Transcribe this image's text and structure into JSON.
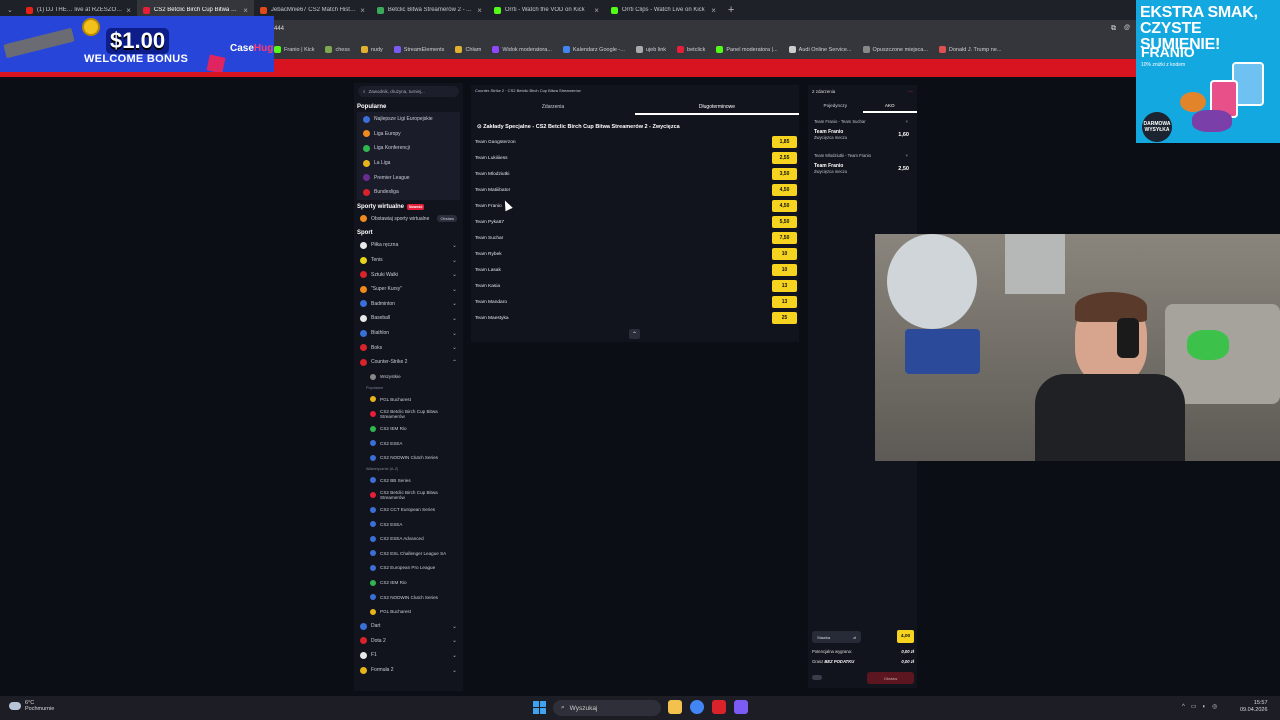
{
  "browser": {
    "tabs": [
      {
        "title": "(1) DJ THE… live at RZESZOW…",
        "color": "#e62117"
      },
      {
        "title": "CS2 Betclic Birch Cup Bitwa Str…",
        "color": "#e81d37",
        "active": true
      },
      {
        "title": "JebacMnie67 CS2 Match Histo…",
        "color": "#e04a1a"
      },
      {
        "title": "Betclic Bitwa Streamerów 2 - A…",
        "color": "#3ba95a"
      },
      {
        "title": "Orrti - Watch the VOD on Kick",
        "color": "#53fc18"
      },
      {
        "title": "Orrti Clips - Watch Live on Kick",
        "color": "#53fc18"
      }
    ],
    "address_fragment": "444",
    "bookmarks": [
      {
        "label": "Franio | Kick",
        "color": "#53fc18"
      },
      {
        "label": "chess",
        "color": "#7fa650"
      },
      {
        "label": "nudy",
        "color": "#e0b030"
      },
      {
        "label": "StreamElements",
        "color": "#7a5cf5"
      },
      {
        "label": "Chłam",
        "color": "#e0b030"
      },
      {
        "label": "Widok moderatora...",
        "color": "#9146ff"
      },
      {
        "label": "Kalendarz Google -...",
        "color": "#4285f4"
      },
      {
        "label": "ujeb link",
        "color": "#aaaaaa"
      },
      {
        "label": "betclick",
        "color": "#e81d37"
      },
      {
        "label": "Panel moderatora |...",
        "color": "#53fc18"
      },
      {
        "label": "Audi Online Service...",
        "color": "#cccccc"
      },
      {
        "label": "Opuszczone miejsca...",
        "color": "#888888"
      },
      {
        "label": "Donald J. Trump ne...",
        "color": "#e05050"
      }
    ]
  },
  "ads": {
    "left": {
      "amount": "$1.00",
      "text": "WELCOME BONUS",
      "brand_a": "Case",
      "brand_b": "Hug"
    },
    "right": {
      "headline": "EKSTRA SMAK, CZYSTE SUMIENIE!",
      "brand": "FRANIO",
      "sub": "10% zniżki z kodem",
      "badge": "DARMOWA WYSYŁKA"
    }
  },
  "sidebar": {
    "search_placeholder": "Zawodnik, drużyna, turniej...",
    "popular_title": "Popularne",
    "popular": [
      {
        "label": "Najlepsze Ligi Europejskie",
        "color": "#3b6fd8"
      },
      {
        "label": "Liga Europy",
        "color": "#f08a1c"
      },
      {
        "label": "Liga Konferencji",
        "color": "#2fb64e"
      },
      {
        "label": "La Liga",
        "color": "#e8b41c"
      },
      {
        "label": "Premier League",
        "color": "#6b2c91"
      },
      {
        "label": "Bundesliga",
        "color": "#d9222a"
      }
    ],
    "virtual_title": "Sporty wirtualne",
    "virtual_badge": "Nowość",
    "virtual_item": "Obstawiaj sporty wirtualne",
    "virtual_btn": "Obstaw",
    "sport_title": "Sport",
    "sports": [
      {
        "label": "Piłka ręczna",
        "color": "#e8e8e8"
      },
      {
        "label": "Tenis",
        "color": "#e6d51a"
      },
      {
        "label": "Sztuki Walki",
        "color": "#d9222a"
      },
      {
        "label": "\"Super Kursy\"",
        "color": "#f08a1c"
      },
      {
        "label": "Badminton",
        "color": "#3b6fd8"
      },
      {
        "label": "Baseball",
        "color": "#e8e8e8"
      },
      {
        "label": "Biathlon",
        "color": "#3b6fd8"
      },
      {
        "label": "Boks",
        "color": "#d9222a"
      },
      {
        "label": "Counter-Strike 2",
        "color": "#d9222a"
      }
    ],
    "cs_all": "Wszystkie",
    "cs_popular_label": "Popularne",
    "cs_popular": [
      {
        "label": "PGL Bucharest",
        "color": "#e8b41c"
      },
      {
        "label": "CS2 Betclic Birch Cup Bitwa Streamerów",
        "color": "#e81d37"
      },
      {
        "label": "CS2 IEM Rio",
        "color": "#2fb64e"
      },
      {
        "label": "CS2 ESEA",
        "color": "#3b6fd8"
      },
      {
        "label": "CS2 NODWIN Clutch Series",
        "color": "#3b6fd8"
      }
    ],
    "cs_az_label": "Alfabetycznie (A-Z)",
    "cs_az": [
      {
        "label": "CS2 BB Series",
        "color": "#3b6fd8"
      },
      {
        "label": "CS2 Betclic Birch Cup Bitwa Streamerów",
        "color": "#e81d37"
      },
      {
        "label": "CS2 CCT European Series",
        "color": "#3b6fd8"
      },
      {
        "label": "CS2 ESEA",
        "color": "#3b6fd8"
      },
      {
        "label": "CS2 ESEA Advanced",
        "color": "#3b6fd8"
      },
      {
        "label": "CS2 ESL Challenger League SA",
        "color": "#3b6fd8"
      },
      {
        "label": "CS2 European Pro League",
        "color": "#3b6fd8"
      },
      {
        "label": "CS2 IEM Rio",
        "color": "#2fb64e"
      },
      {
        "label": "CS2 NODWIN Clutch Series",
        "color": "#3b6fd8"
      },
      {
        "label": "PGL Bucharest",
        "color": "#e8b41c"
      }
    ],
    "more_sports": [
      {
        "label": "Dart",
        "color": "#3b6fd8"
      },
      {
        "label": "Dota 2",
        "color": "#d9222a"
      },
      {
        "label": "F1",
        "color": "#e8e8e8"
      },
      {
        "label": "Formuła 2",
        "color": "#e8b41c"
      }
    ]
  },
  "main": {
    "breadcrumb": "Counter-Strike 2 · CS2 Betclic Birch Cup Bitwa Streamerów",
    "tabs": [
      "Zdarzenia",
      "Długoterminowe"
    ],
    "market_title": "Zakłady Specjalne - CS2 Betclic Birch Cup Bitwa Streamerów 2 - Zwycięzca",
    "outcomes": [
      {
        "team": "Team Gangsterzon",
        "odd": "1,85"
      },
      {
        "team": "Team Lukiiiiess",
        "odd": "2,55"
      },
      {
        "team": "Team Mlodziutki",
        "odd": "3,50"
      },
      {
        "team": "Team Matiiibator",
        "odd": "4,50"
      },
      {
        "team": "Team Franio",
        "odd": "4,50"
      },
      {
        "team": "Team Pyka67",
        "odd": "5,50"
      },
      {
        "team": "Team Suchar",
        "odd": "7,50"
      },
      {
        "team": "Team Rybek",
        "odd": "10"
      },
      {
        "team": "Team Lasak",
        "odd": "10"
      },
      {
        "team": "Team Kasia",
        "odd": "13"
      },
      {
        "team": "Team Mandaro",
        "odd": "13"
      },
      {
        "team": "Team Maestyka",
        "odd": "25"
      }
    ]
  },
  "slip": {
    "header": "2 zdarzenia",
    "tabs": [
      "Pojedynczy",
      "AKO"
    ],
    "selections": [
      {
        "match": "Team Franio - Team Suchar",
        "pick": "Team Franio",
        "market": "Zwycięzca meczu",
        "odd": "1,60"
      },
      {
        "match": "Team Mlodziutki - Team Franio",
        "pick": "Team Franio",
        "market": "Zwycięzca meczu",
        "odd": "2,50"
      }
    ],
    "stake_label": "Stawka",
    "stake_currency": "zł",
    "total_odds": "4,00",
    "potential_label": "Potencjalna wygrana:",
    "potential_value": "0,00 zł",
    "tax_label": "Grasz",
    "tax_brand": "BEZ PODATKU",
    "tax_value": "0,00 zł",
    "place_label": "Obstaw"
  },
  "taskbar": {
    "temp": "6°C",
    "weather": "Pochmurnie",
    "search": "Wyszukaj",
    "time": "15:57",
    "date": "09.04.2026"
  }
}
